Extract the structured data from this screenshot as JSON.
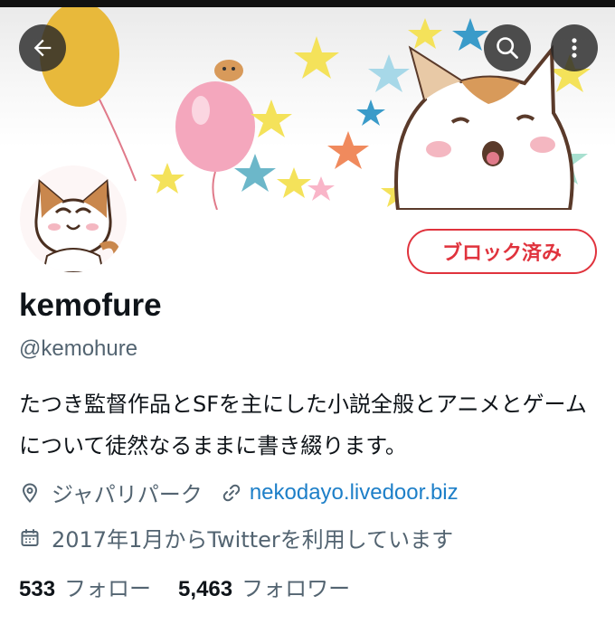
{
  "header": {
    "back_icon": "arrow-left-icon",
    "search_icon": "search-icon",
    "more_icon": "more-vertical-icon"
  },
  "profile": {
    "display_name": "kemofure",
    "handle": "@kemohure",
    "blocked_label": "ブロック済み",
    "bio": "たつき監督作品とSFを主にした小説全般とアニメとゲームについて徒然なるままに書き綴ります。",
    "location": "ジャパリパーク",
    "website": "nekodayo.livedoor.biz",
    "joined": "2017年1月からTwitterを利用しています",
    "following_count": "533",
    "following_label": "フォロー",
    "followers_count": "5,463",
    "followers_label": "フォロワー"
  },
  "colors": {
    "blocked": "#e0333d",
    "link": "#1d7fc8",
    "secondary_text": "#536471"
  }
}
